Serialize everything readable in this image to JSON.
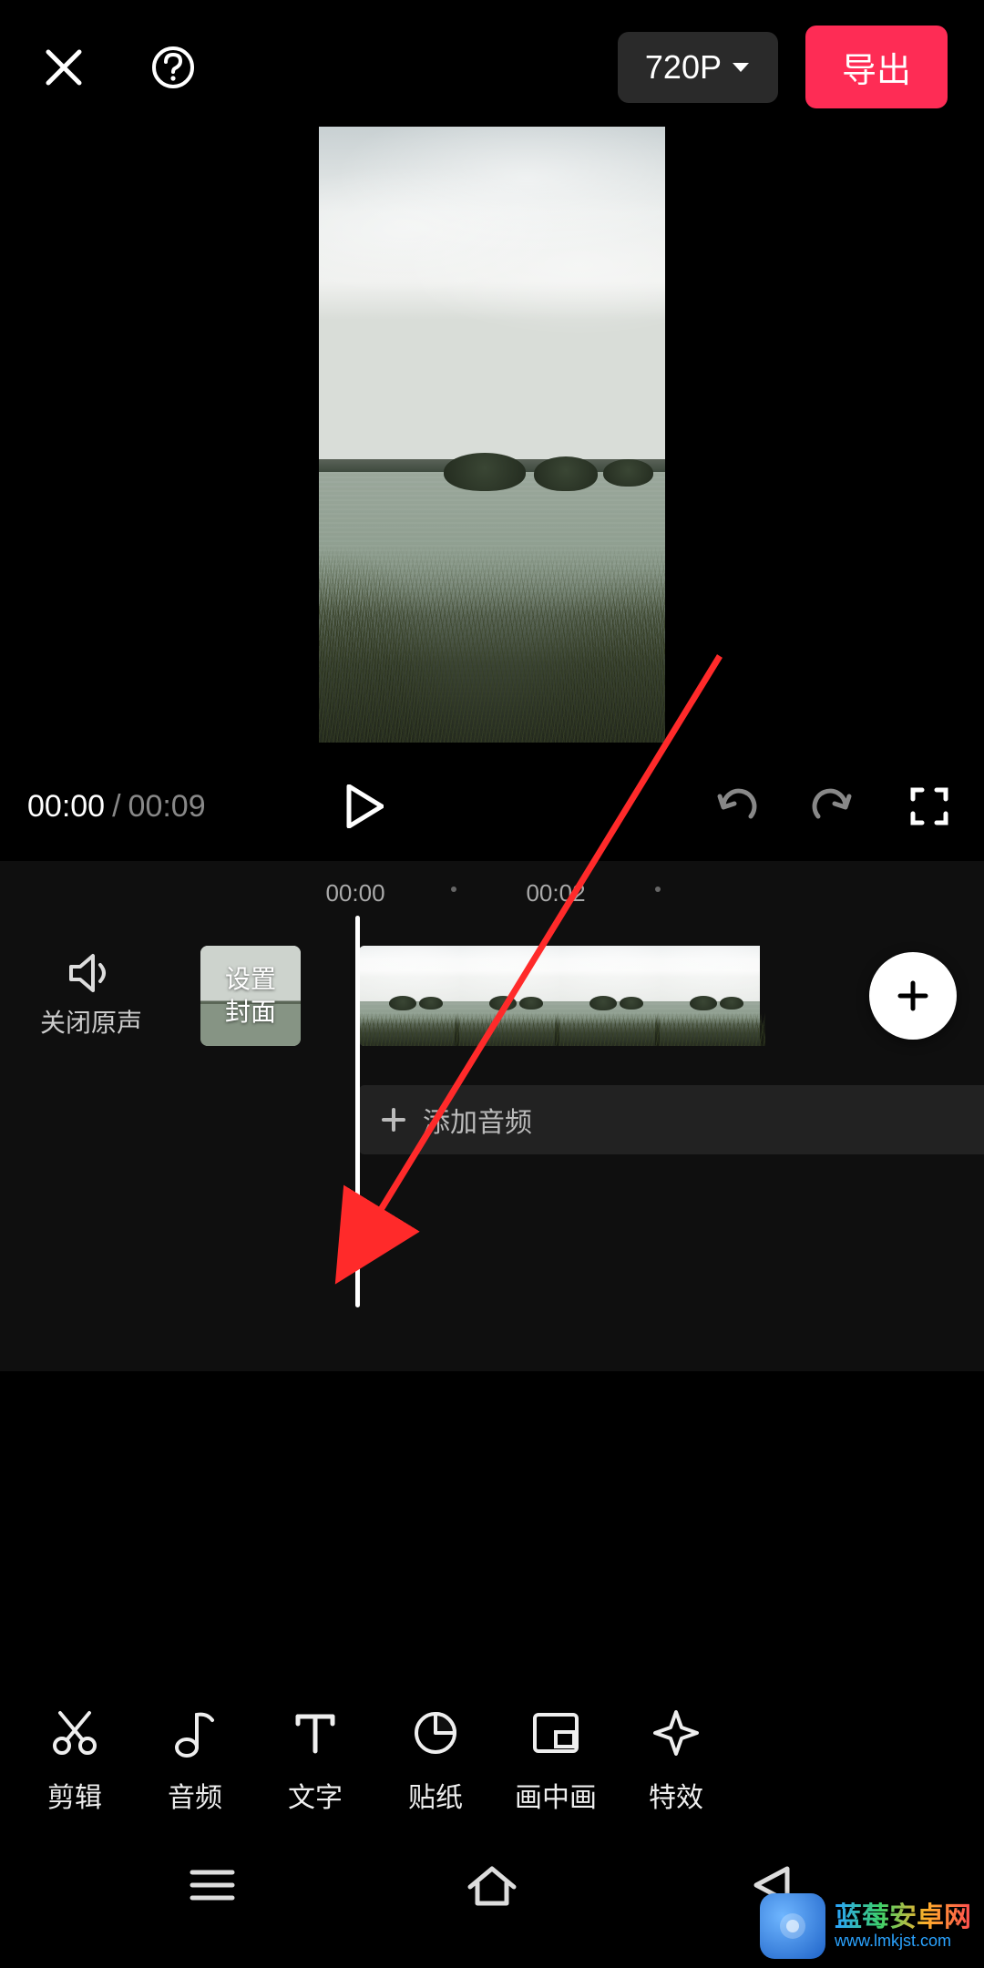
{
  "header": {
    "resolution_label": "720P",
    "export_label": "导出"
  },
  "playback": {
    "current_time": "00:00",
    "separator": "/",
    "total_time": "00:09"
  },
  "timeline": {
    "tick_labels": [
      "00:00",
      "00:02"
    ],
    "mute_label": "关闭原声",
    "set_cover_line1": "设置",
    "set_cover_line2": "封面",
    "add_audio_label": "添加音频"
  },
  "toolbar": {
    "items": [
      {
        "label": "剪辑"
      },
      {
        "label": "音频"
      },
      {
        "label": "文字"
      },
      {
        "label": "贴纸"
      },
      {
        "label": "画中画"
      },
      {
        "label": "特效"
      }
    ]
  },
  "watermark": {
    "title": "蓝莓安卓网",
    "url": "www.lmkjst.com"
  },
  "colors": {
    "accent": "#fe2c55"
  }
}
